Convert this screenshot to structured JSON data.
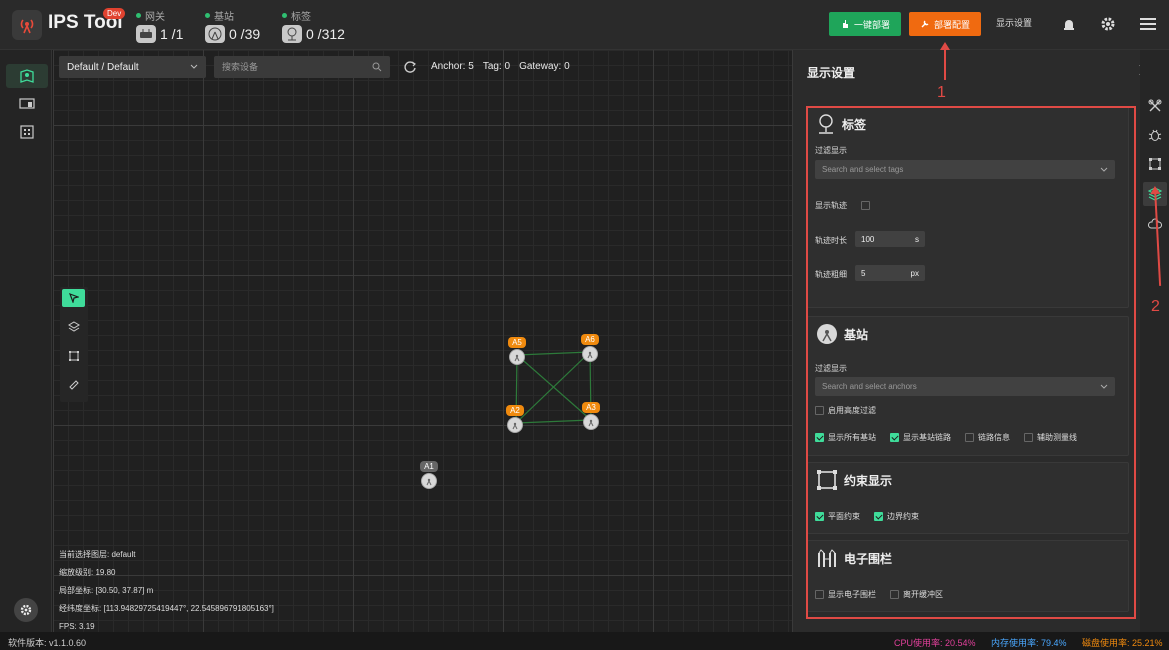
{
  "app": {
    "title": "IPS Tool",
    "badge": "Dev"
  },
  "stats": [
    {
      "label": "网关",
      "value": "1 /1",
      "icon": "router-icon"
    },
    {
      "label": "基站",
      "value": "0 /39",
      "icon": "anchor-icon"
    },
    {
      "label": "标签",
      "value": "0 /312",
      "icon": "tag-pin-icon"
    }
  ],
  "header": {
    "deploy_label": "一键部署",
    "config_label": "部署配置",
    "display_label": "显示设置"
  },
  "toolbar": {
    "scene_select": "Default / Default",
    "search_placeholder": "搜索设备",
    "anchor_count": "Anchor: 5",
    "tag_count": "Tag: 0",
    "gateway_count": "Gateway: 0"
  },
  "anchors": [
    {
      "id": "A5",
      "color": "#f08a0e"
    },
    {
      "id": "A6",
      "color": "#f08a0e"
    },
    {
      "id": "A2",
      "color": "#f08a0e"
    },
    {
      "id": "A3",
      "color": "#f08a0e"
    },
    {
      "id": "A1",
      "color": "#666666"
    }
  ],
  "info": {
    "layer_label": "当前选择图层:",
    "layer_value": "default",
    "zoom_label": "缩放级别:",
    "zoom_value": "19.80",
    "local_label": "局部坐标:",
    "local_value": "[30.50, 37.87] m",
    "geo_label": "经纬度坐标:",
    "geo_value": "[113.94829725419447°, 22.545896791805163°]",
    "fps_label": "FPS:",
    "fps_value": "3.19"
  },
  "panel": {
    "title": "显示设置",
    "tags": {
      "title": "标签",
      "filter_label": "过滤显示",
      "filter_placeholder": "Search and select tags",
      "show_track_label": "显示轨迹",
      "track_duration_label": "轨迹时长",
      "track_duration_value": "100",
      "track_duration_unit": "s",
      "track_width_label": "轨迹粗细",
      "track_width_value": "5",
      "track_width_unit": "px"
    },
    "anchors": {
      "title": "基站",
      "filter_label": "过滤显示",
      "filter_placeholder": "Search and select anchors",
      "height_filter_label": "启用高度过滤",
      "show_all_label": "显示所有基站",
      "show_links_label": "显示基站链路",
      "link_info_label": "链路信息",
      "aux_line_label": "辅助测量线"
    },
    "constraints": {
      "title": "约束显示",
      "plane_label": "平面约束",
      "boundary_label": "边界约束"
    },
    "fence": {
      "title": "电子围栏",
      "show_fence_label": "显示电子围栏",
      "buffer_label": "离开缓冲区"
    }
  },
  "annotations": {
    "marker1": "1",
    "marker2": "2"
  },
  "status": {
    "version_label": "软件版本: v1.1.0.60",
    "cpu": "CPU使用率: 20.54%",
    "mem": "内存使用率: 79.4%",
    "disk": "磁盘使用率: 25.21%"
  },
  "colors": {
    "accent": "#3fdc9a",
    "deploy": "#1fa55a",
    "config": "#f06a10",
    "annotation": "#e04a45",
    "cpu": "#e0409a",
    "mem": "#4aa8ff",
    "disk": "#f08a0e"
  }
}
